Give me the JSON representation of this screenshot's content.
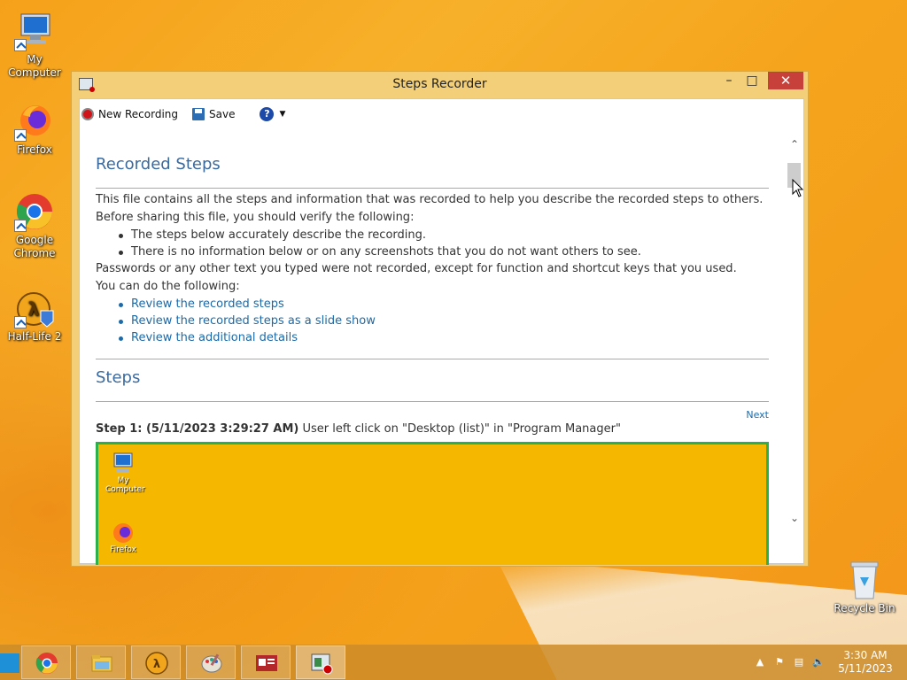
{
  "desktop": {
    "icons": [
      {
        "label": "My Computer",
        "icon": "my-computer-icon"
      },
      {
        "label": "Firefox",
        "icon": "firefox-icon"
      },
      {
        "label": "Google Chrome",
        "icon": "chrome-icon"
      },
      {
        "label": "Half-Life 2",
        "icon": "half-life-2-icon"
      },
      {
        "label": "Recycle Bin",
        "icon": "recycle-bin-icon"
      }
    ]
  },
  "window": {
    "title": "Steps Recorder",
    "toolbar": {
      "new_recording": "New Recording",
      "save": "Save"
    }
  },
  "doc": {
    "heading_recorded": "Recorded Steps",
    "intro1": "This file contains all the steps and information that was recorded to help you describe the recorded steps to others.",
    "intro2": "Before sharing this file, you should verify the following:",
    "verify": [
      "The steps below accurately describe the recording.",
      "There is no information below or on any screenshots that you do not want others to see."
    ],
    "intro3": "Passwords or any other text you typed were not recorded, except for function and shortcut keys that you used.",
    "intro4": "You can do the following:",
    "links": [
      "Review the recorded steps",
      "Review the recorded steps as a slide show",
      "Review the additional details"
    ],
    "heading_steps": "Steps",
    "next": "Next",
    "step1_label": "Step 1: (5/11/2023 3:29:27 AM)",
    "step1_text": "User left click on \"Desktop (list)\" in \"Program Manager\"",
    "screenshot_icons": [
      "My Computer",
      "Firefox"
    ]
  },
  "taskbar": {
    "apps": [
      "chrome-icon",
      "file-explorer-icon",
      "half-life-2-icon",
      "paint-icon",
      "news-icon",
      "steps-recorder-icon"
    ],
    "time": "3:30 AM",
    "date": "5/11/2023"
  }
}
